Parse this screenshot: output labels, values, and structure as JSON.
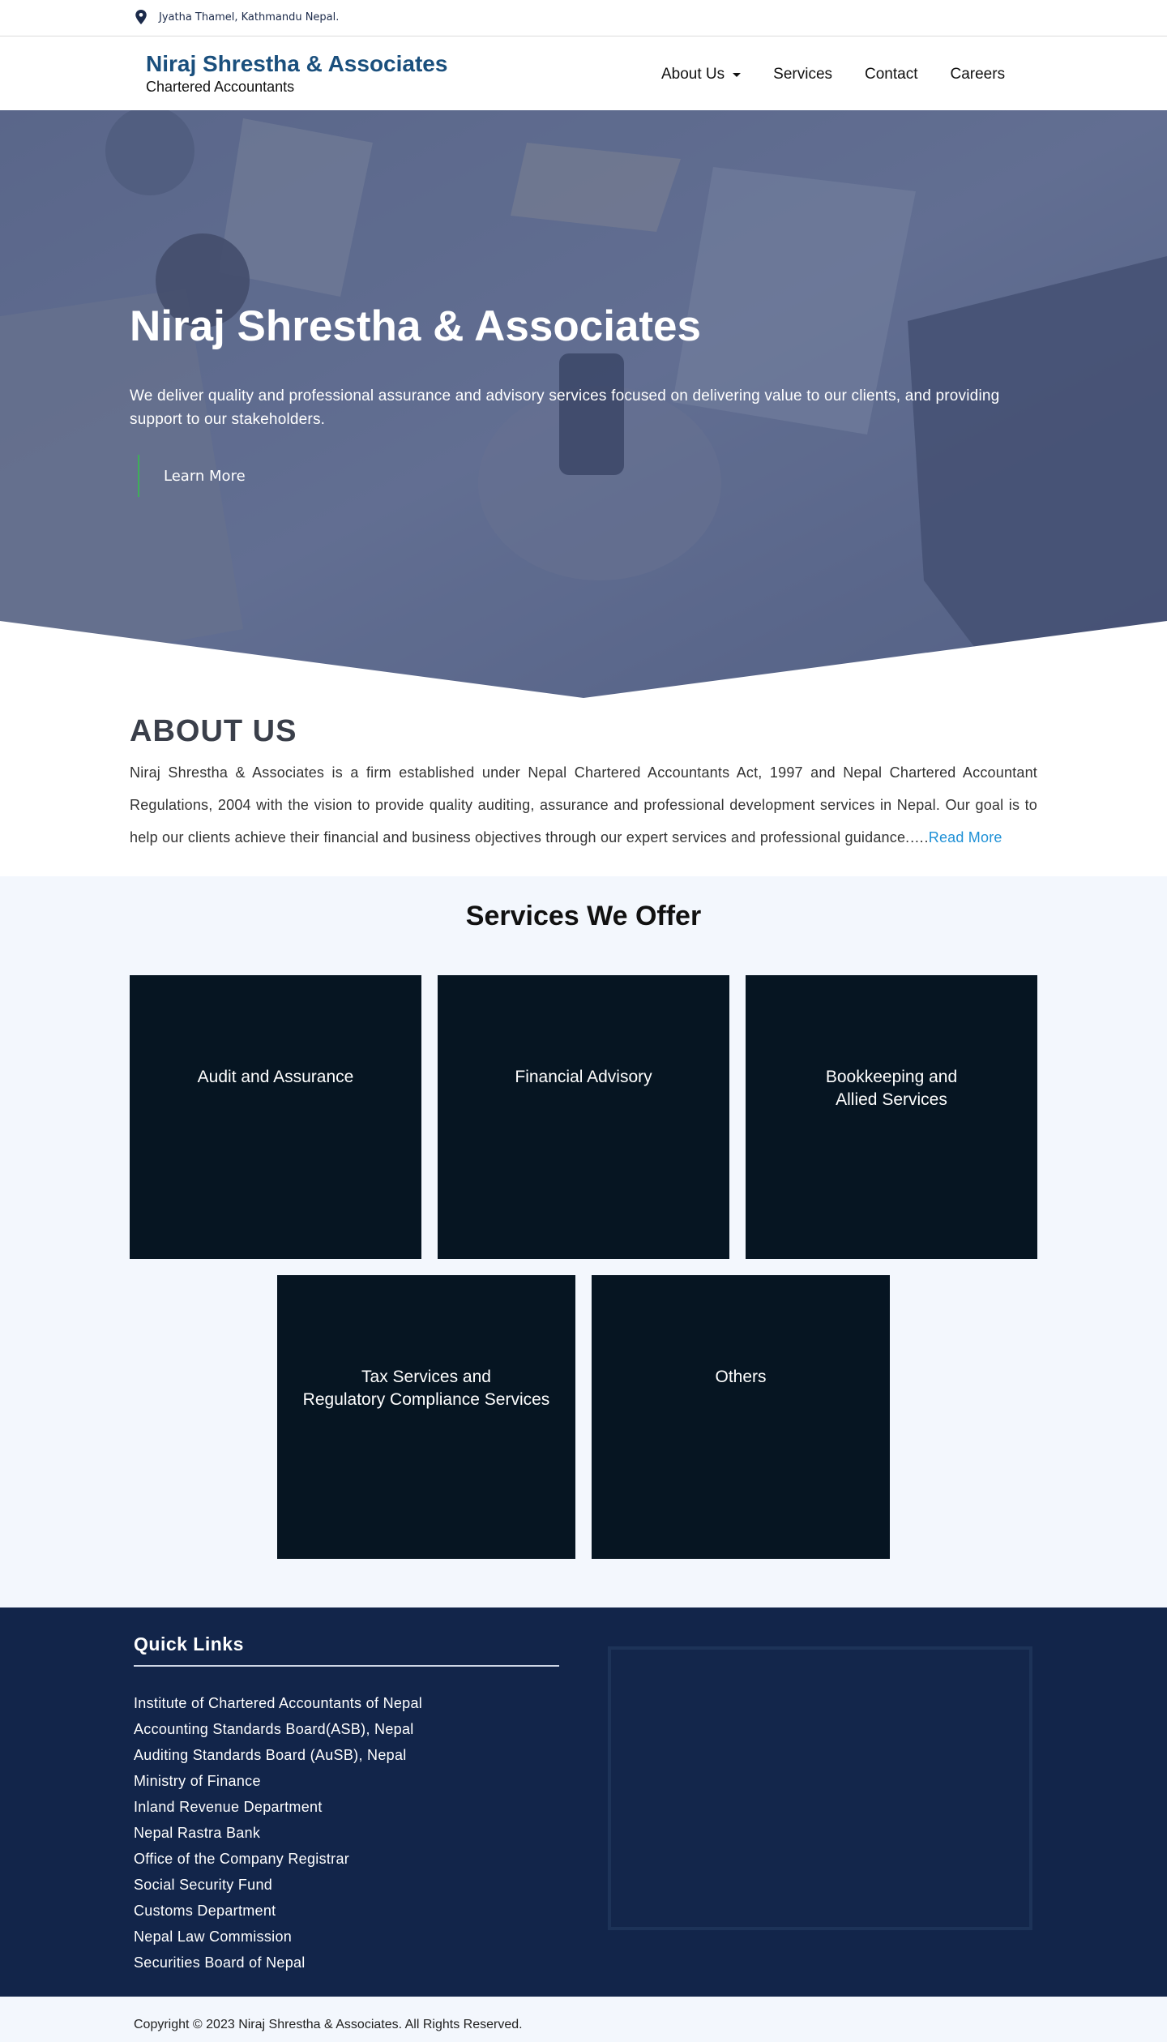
{
  "topbar": {
    "address": "Jyatha Thamel, Kathmandu Nepal."
  },
  "header": {
    "brand_name": "Niraj Shrestha & Associates",
    "brand_sub": "Chartered Accountants",
    "nav": [
      {
        "label": "About Us",
        "has_dropdown": true
      },
      {
        "label": "Services"
      },
      {
        "label": "Contact"
      },
      {
        "label": "Careers"
      }
    ]
  },
  "hero": {
    "title": "Niraj Shrestha & Associates",
    "text": "We deliver quality and professional assurance and advisory services focused on delivering value to our clients, and providing support to our stakeholders.",
    "button": "Learn More",
    "button_accent": "#3fae5a"
  },
  "about": {
    "title": "ABOUT US",
    "text": "Niraj Shrestha & Associates is a firm established under Nepal Chartered Accountants Act, 1997 and Nepal Chartered Accountant Regulations, 2004 with the vision to provide quality auditing, assurance and professional development services in Nepal. Our goal is to help our clients achieve their financial and business objectives through our expert services and professional guidance.….",
    "read_more": "Read More"
  },
  "services": {
    "title": "Services We Offer",
    "cards": [
      {
        "label": "Audit and Assurance"
      },
      {
        "label": "Financial Advisory"
      },
      {
        "label": "Bookkeeping and\nAllied Services"
      },
      {
        "label": "Tax Services and\nRegulatory Compliance Services"
      },
      {
        "label": "Others"
      }
    ]
  },
  "footer": {
    "quick_links_title": "Quick Links",
    "links": [
      "Institute of Chartered Accountants of Nepal",
      "Accounting Standards Board(ASB), Nepal",
      "Auditing Standards Board (AuSB), Nepal",
      "Ministry of Finance",
      "Inland Revenue Department",
      "Nepal Rastra Bank",
      "Office of the Company Registrar",
      "Social Security Fund",
      "Customs Department",
      "Nepal Law Commission",
      "Securities Board of Nepal"
    ],
    "copyright": "Copyright © 2023 Niraj Shrestha & Associates. All Rights Reserved."
  },
  "colors": {
    "brand": "#1a4f7d",
    "hero_overlay": "#4a5a80",
    "card_bg": "#061522",
    "footer_bg": "#12254a",
    "link": "#1e90d6"
  },
  "icons": {
    "address": "map-pin-icon",
    "dropdown": "caret-down-icon"
  }
}
